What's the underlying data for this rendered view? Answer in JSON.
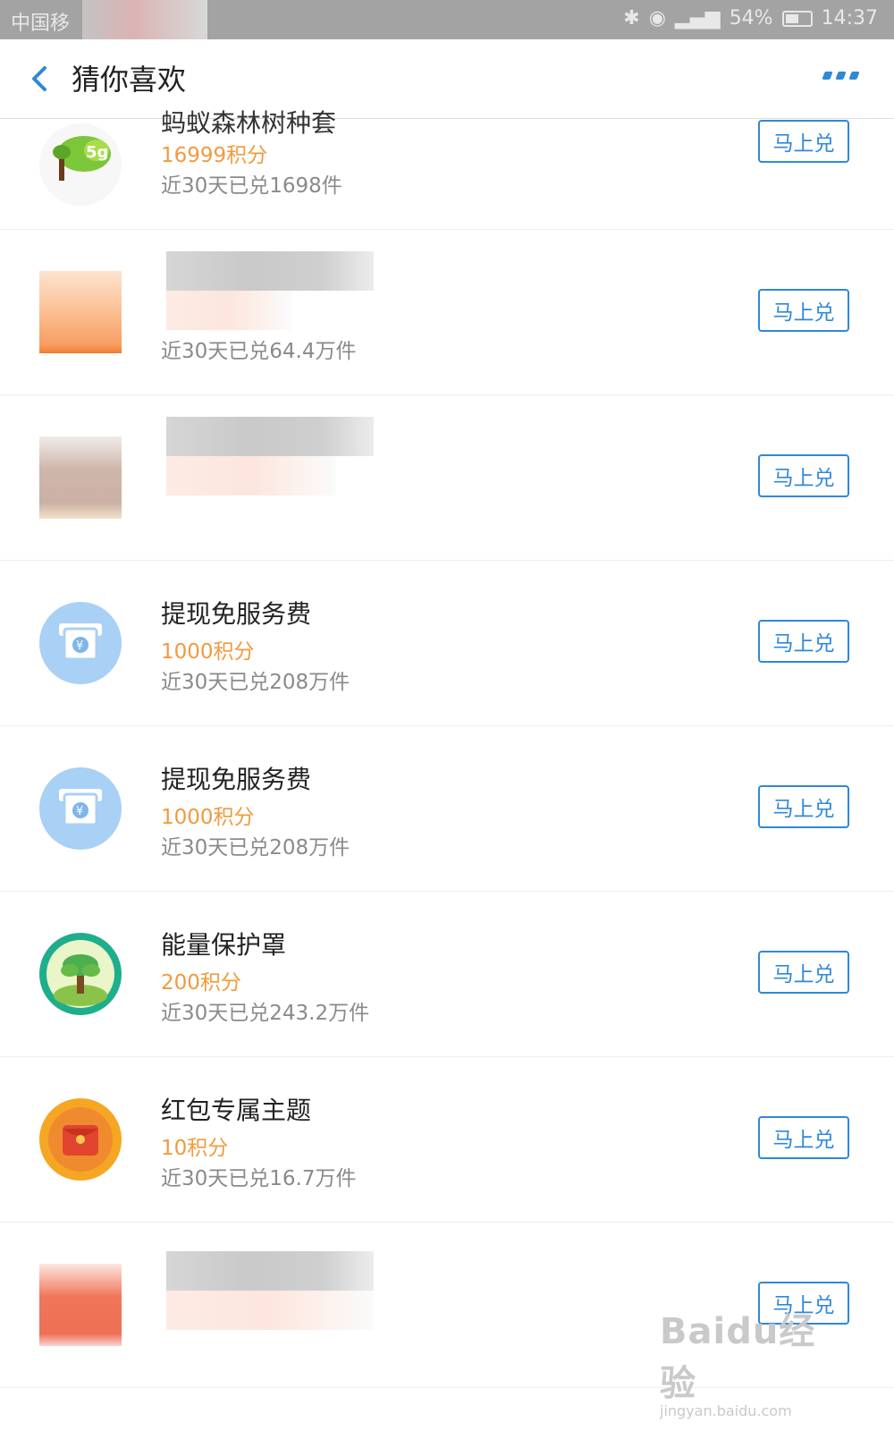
{
  "status_bar": {
    "carrier": "中国移",
    "battery": "54%",
    "time": "14:37"
  },
  "header": {
    "title": "猜你喜欢"
  },
  "items": [
    {
      "name": "蚂蚁森林树种套",
      "points": "16999积分",
      "sold": "近30天已兑1698件",
      "button": "马上兑",
      "icon": "forest-tree-5g-icon"
    },
    {
      "name": "",
      "points": "",
      "sold": "近30天已兑64.4万件",
      "button": "马上兑",
      "icon": "blurred-orange-icon"
    },
    {
      "name": "",
      "points": "",
      "sold": "",
      "button": "马上兑",
      "icon": "blurred-brown-icon"
    },
    {
      "name": "提现免服务费",
      "points": "1000积分",
      "sold": "近30天已兑208万件",
      "button": "马上兑",
      "icon": "atm-withdraw-icon"
    },
    {
      "name": "提现免服务费",
      "points": "1000积分",
      "sold": "近30天已兑208万件",
      "button": "马上兑",
      "icon": "atm-withdraw-icon"
    },
    {
      "name": "能量保护罩",
      "points": "200积分",
      "sold": "近30天已兑243.2万件",
      "button": "马上兑",
      "icon": "tree-shield-icon"
    },
    {
      "name": "红包专属主题",
      "points": "10积分",
      "sold": "近30天已兑16.7万件",
      "button": "马上兑",
      "icon": "red-envelope-icon"
    },
    {
      "name": "",
      "points": "",
      "sold": "",
      "button": "马上兑",
      "icon": "blurred-red-icon"
    }
  ],
  "watermark": {
    "logo": "Baidu经验",
    "url": "jingyan.baidu.com"
  }
}
